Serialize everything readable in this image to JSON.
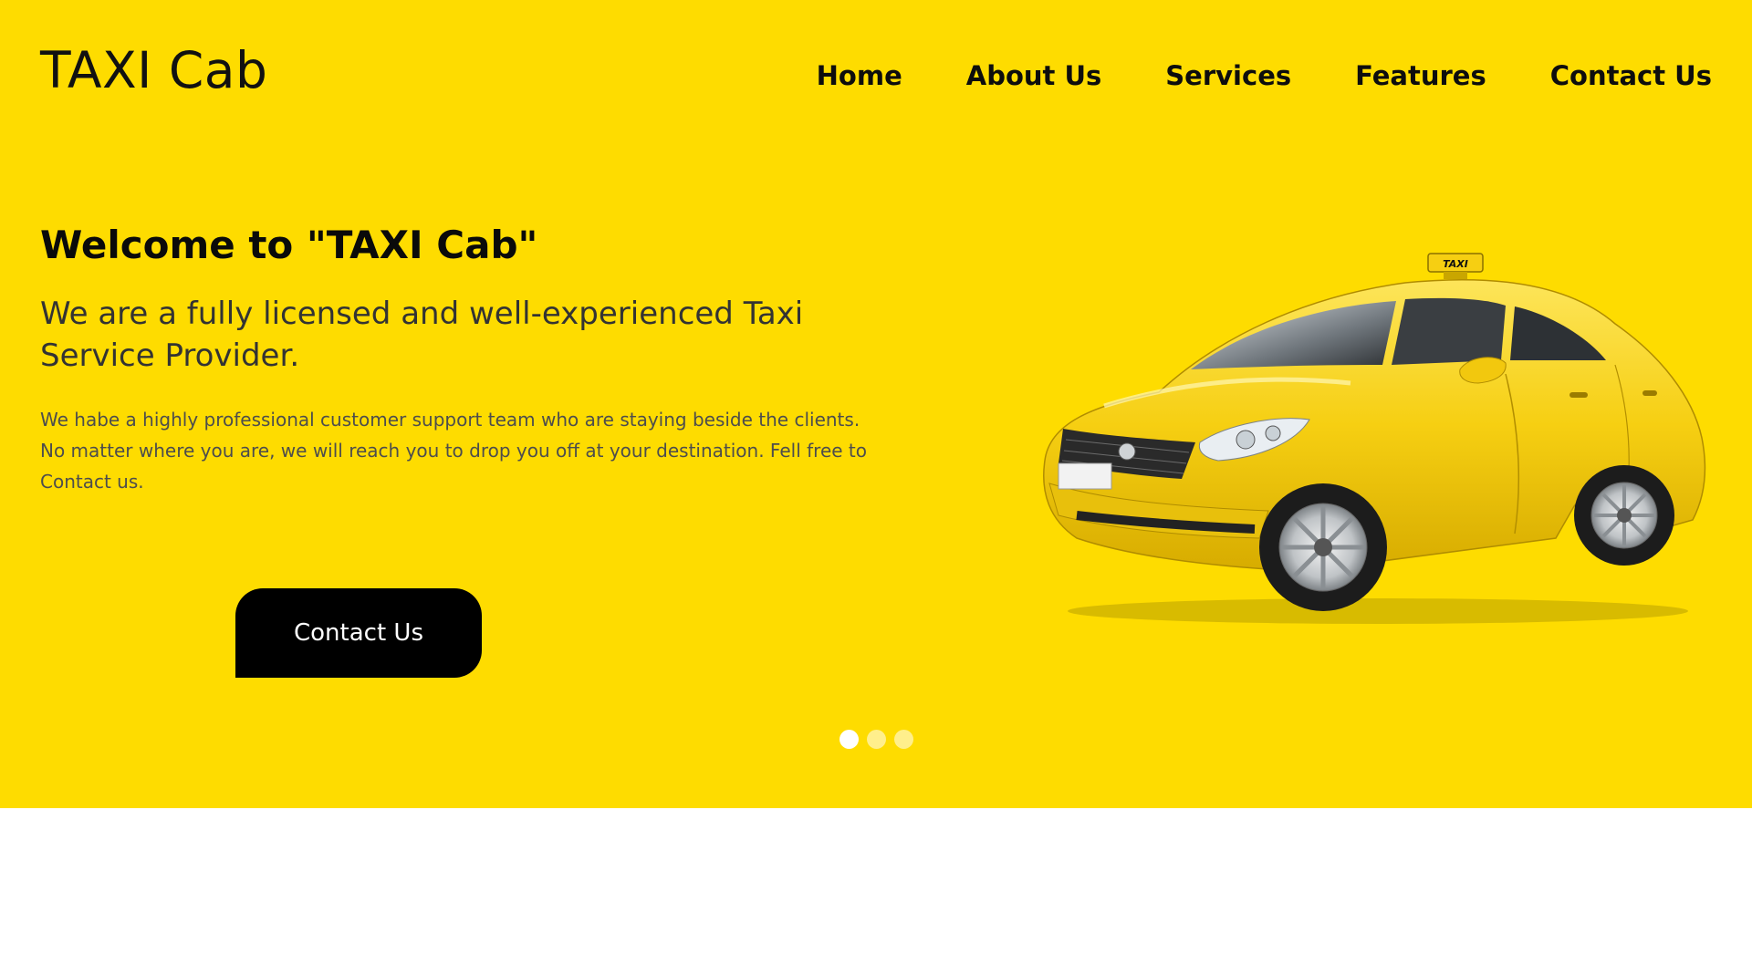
{
  "brand": {
    "name": "TAXI Cab"
  },
  "nav": {
    "items": [
      {
        "label": "Home"
      },
      {
        "label": "About Us"
      },
      {
        "label": "Services"
      },
      {
        "label": "Features"
      },
      {
        "label": "Contact Us"
      }
    ]
  },
  "hero": {
    "title": "Welcome to \"TAXI Cab\"",
    "subtitle": "We are a fully licensed and well-experienced Taxi Service Provider.",
    "body": "We habe a highly professional customer support team who are staying beside the clients. No matter where you are, we will reach you to drop you off at your destination. Fell free to Contact us.",
    "cta_label": "Contact Us",
    "car_sign_text": "TAXI"
  },
  "slider": {
    "count": 3,
    "active": 1
  },
  "colors": {
    "hero_background": "#fedc00",
    "button_background": "#000000",
    "taxi_body": "#f6cf12"
  },
  "icons": {
    "car_image": "taxi-car-icon"
  }
}
